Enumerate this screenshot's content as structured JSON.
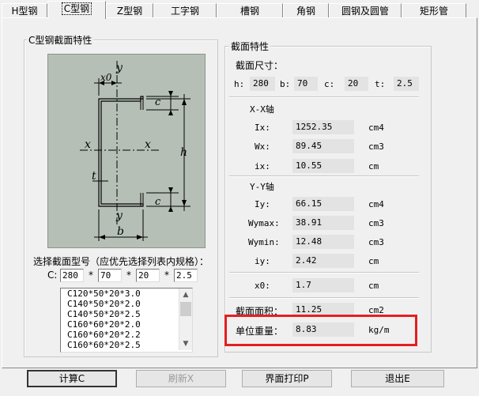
{
  "tabs": [
    "H型钢",
    "C型钢",
    "Z型钢",
    "工字钢",
    "槽钢",
    "角钢",
    "圆钢及圆管",
    "矩形管"
  ],
  "left_group": {
    "title": "C型钢截面特性",
    "diagram_labels": {
      "y_top": "y",
      "x0": "x0",
      "c_top": "c",
      "x_left": "x",
      "x_right": "x",
      "h": "h",
      "t": "t",
      "c_bottom": "c",
      "y_bottom": "y",
      "b": "b"
    },
    "select_prompt": "选择截面型号（应优先选择列表内规格）：",
    "c_label": "C:",
    "inputs": [
      "280",
      "70",
      "20",
      "2.5"
    ],
    "star": "*",
    "list_items": [
      "C120*50*20*3.0",
      "C140*50*20*2.0",
      "C140*50*20*2.5",
      "C160*60*20*2.0",
      "C160*60*20*2.2",
      "C160*60*20*2.5"
    ]
  },
  "right_group": {
    "title": "截面特性",
    "size_label": "截面尺寸：",
    "dims": [
      {
        "label": "h:",
        "value": "280"
      },
      {
        "label": "b:",
        "value": "70"
      },
      {
        "label": "c:",
        "value": "20"
      },
      {
        "label": "t:",
        "value": "2.5"
      }
    ],
    "xx_title": "X-X轴",
    "xx_rows": [
      {
        "label": "Ix:",
        "value": "1252.35",
        "unit": "cm4"
      },
      {
        "label": "Wx:",
        "value": "89.45",
        "unit": "cm3"
      },
      {
        "label": "ix:",
        "value": "10.55",
        "unit": "cm"
      }
    ],
    "yy_title": "Y-Y轴",
    "yy_rows": [
      {
        "label": "Iy:",
        "value": "66.15",
        "unit": "cm4"
      },
      {
        "label": "Wymax:",
        "value": "38.91",
        "unit": "cm3"
      },
      {
        "label": "Wymin:",
        "value": "12.48",
        "unit": "cm3"
      },
      {
        "label": "iy:",
        "value": "2.42",
        "unit": "cm"
      }
    ],
    "x0": {
      "label": "x0:",
      "value": "1.7",
      "unit": "cm"
    },
    "area": {
      "label": "截面面积：",
      "value": "11.25",
      "unit": "cm2"
    },
    "weight": {
      "label": "单位重量：",
      "value": "8.83",
      "unit": "kg/m"
    }
  },
  "buttons": {
    "calc": "计算C",
    "refresh": "刷新X",
    "print": "界面打印P",
    "exit": "退出E"
  },
  "colors": {
    "highlight": "#e41f1f",
    "diagram_bg": "#b6bfb6"
  }
}
